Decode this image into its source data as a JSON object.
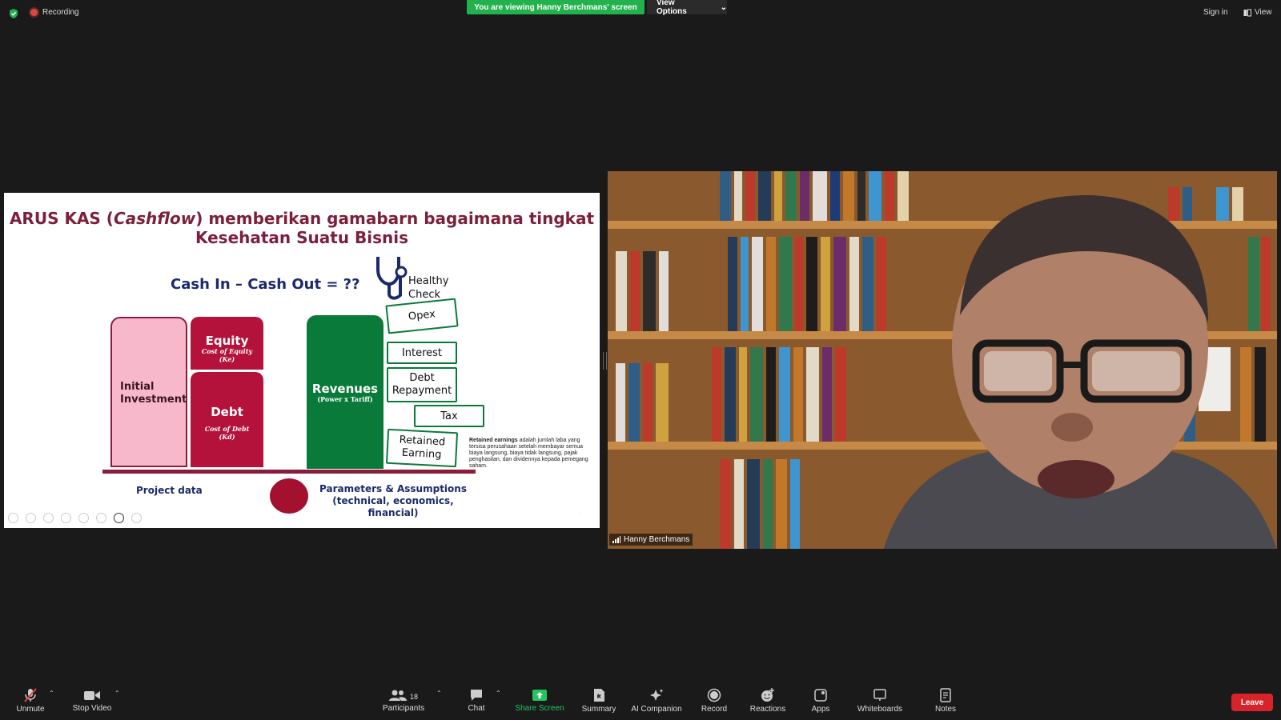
{
  "topbar": {
    "recording": "Recording",
    "viewing_banner": "You are viewing Hanny Berchmans' screen",
    "view_options": "View Options",
    "sign_in": "Sign in",
    "view": "View"
  },
  "slide": {
    "title_line1_pre": "ARUS KAS (",
    "title_line1_italic": "Cashflow",
    "title_line1_post": ") memberikan gamabarn bagaimana tingkat",
    "title_line2": "Kesehatan Suatu Bisnis",
    "equation": "Cash In – Cash Out  = ??",
    "healthy": "Healthy",
    "check": "Check",
    "initial1": "Initial",
    "initial2": "Investment",
    "equity": "Equity",
    "equity_sub1": "Cost of Equity",
    "equity_sub2": "(Ke)",
    "debt": "Debt",
    "debt_sub1": "Cost of Debt",
    "debt_sub2": "(Kd)",
    "revenues": "Revenues",
    "revenues_sub": "(Power x Tariff)",
    "opex": "Opex",
    "interest": "Interest",
    "debt_rep1": "Debt",
    "debt_rep2": "Repayment",
    "tax": "Tax",
    "retained1": "Retained",
    "retained2": "Earning",
    "note_bold": "Retained earnings",
    "note_rest": " adalah jumlah laba yang tersisa perusahaan setelah membayar semua biaya langsung, biaya tidak langsung, pajak penghasilan, dan dividennya kepada pemegang saham.",
    "project_data": "Project data",
    "params1": "Parameters & Assumptions",
    "params2": "(technical, economics, financial)"
  },
  "video": {
    "name": "Hanny Berchmans"
  },
  "toolbar": {
    "unmute": "Unmute",
    "stop_video": "Stop Video",
    "participants": "Participants",
    "participants_count": "18",
    "chat": "Chat",
    "share_screen": "Share Screen",
    "summary": "Summary",
    "ai_companion": "AI Companion",
    "record": "Record",
    "reactions": "Reactions",
    "apps": "Apps",
    "whiteboards": "Whiteboards",
    "notes": "Notes",
    "leave": "Leave"
  },
  "colors": {
    "accent_green": "#22b14c",
    "leave_red": "#d9232a",
    "slide_maroon": "#7b1f3a",
    "slide_green": "#0a7a3a"
  }
}
